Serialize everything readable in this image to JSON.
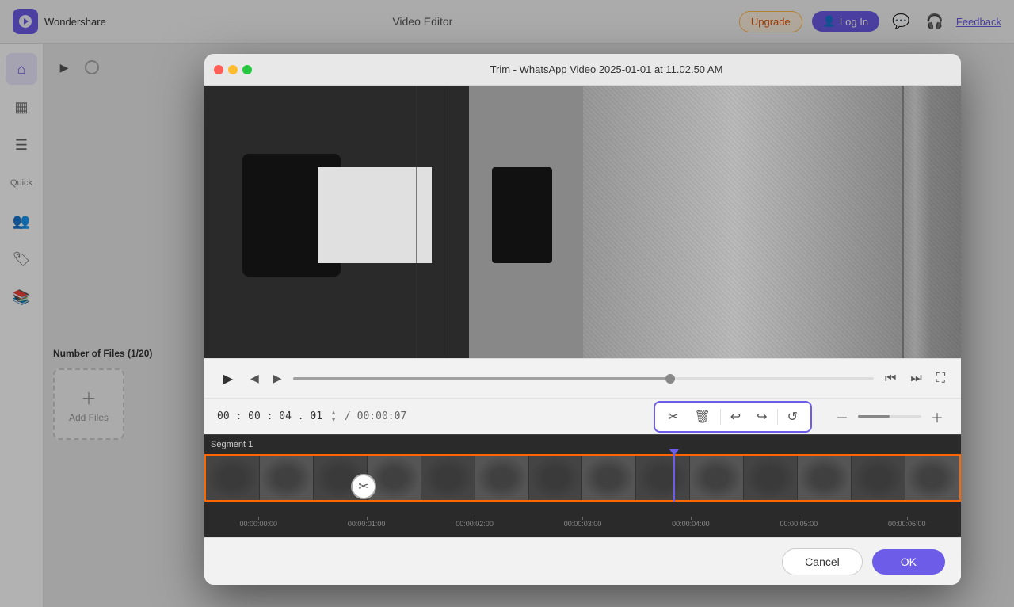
{
  "app": {
    "name": "Wondershare",
    "title": "Video Editor",
    "feedback_label": "Feedback",
    "upgrade_label": "Upgrade",
    "login_label": "Log In"
  },
  "modal": {
    "title": "Trim - WhatsApp Video 2025-01-01 at 11.02.50 AM",
    "segment_label": "Segment 1",
    "time_current": "00 : 00 : 04 . 01",
    "time_total": "/ 00:00:07",
    "cancel_label": "Cancel",
    "ok_label": "OK"
  },
  "timeline": {
    "ruler_marks": [
      "00:00:00:00",
      "00:00:01:00",
      "00:00:02:00",
      "00:00:03:00",
      "00:00:04:00",
      "00:00:05:00",
      "00:00:06:00"
    ]
  },
  "sidebar": {
    "items": [
      {
        "label": "Home",
        "icon": "⌂"
      },
      {
        "label": "Media",
        "icon": "▦"
      },
      {
        "label": "Tools",
        "icon": "≡"
      },
      {
        "label": "Quick",
        "icon": "⚡"
      },
      {
        "label": "Team",
        "icon": "👥"
      },
      {
        "label": "Assets",
        "icon": "📦"
      },
      {
        "label": "Learn",
        "icon": "📚"
      }
    ]
  },
  "left_panel": {
    "files_label": "Number of Files (1/20)",
    "add_files_label": "Add Files"
  }
}
